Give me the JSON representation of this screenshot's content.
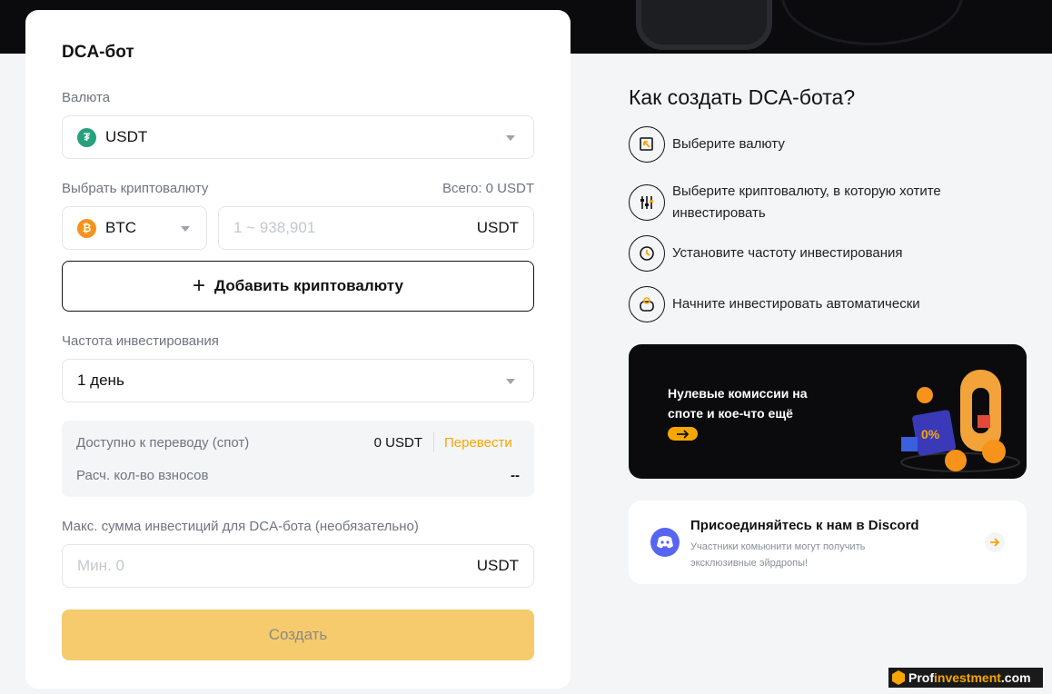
{
  "form": {
    "title": "DCA-бот",
    "currency_label": "Валюта",
    "currency_value": "USDT",
    "currency_icon": "tether-icon",
    "crypto_label": "Выбрать криптовалюту",
    "total_label": "Всего: 0 USDT",
    "crypto_value": "BTC",
    "crypto_icon": "bitcoin-icon",
    "amount_placeholder": "1 ~ 938,901",
    "amount_unit": "USDT",
    "add_crypto_label": "Добавить криптовалюту",
    "frequency_label": "Частота инвестирования",
    "frequency_value": "1 день",
    "available_label": "Доступно к переводу (спот)",
    "available_value": "0 USDT",
    "transfer_label": "Перевести",
    "contributions_label": "Расч. кол-во взносов",
    "contributions_value": "--",
    "max_label": "Макс. сумма инвестиций для DCA-бота (необязательно)",
    "max_placeholder": "Мин. 0",
    "max_unit": "USDT",
    "create_label": "Создать"
  },
  "howto": {
    "title": "Как создать DCA-бота?",
    "steps": [
      {
        "text": "Выберите валюту",
        "icon": "select-currency-icon"
      },
      {
        "text": "Выберите криптовалюту, в которую хотите инвестировать",
        "icon": "sliders-icon"
      },
      {
        "text": "Установите частоту инвестирования",
        "icon": "clock-icon"
      },
      {
        "text": "Начните инвестировать автоматически",
        "icon": "robot-icon"
      }
    ]
  },
  "promo": {
    "text": "Нулевые комиссии на споте и кое-что ещё",
    "badge": "0%"
  },
  "discord": {
    "title": "Присоединяйтесь к нам в Discord",
    "subtitle": "Участники комьюнити могут получить эксклюзивные эйрдропы!"
  },
  "watermark": {
    "part1": "Prof",
    "part2": "investment",
    "part3": ".com"
  },
  "colors": {
    "accent": "#f7a600",
    "create_button": "#f5cb6e",
    "usdt": "#26a17b",
    "btc": "#f7931a",
    "discord": "#5865f2"
  }
}
